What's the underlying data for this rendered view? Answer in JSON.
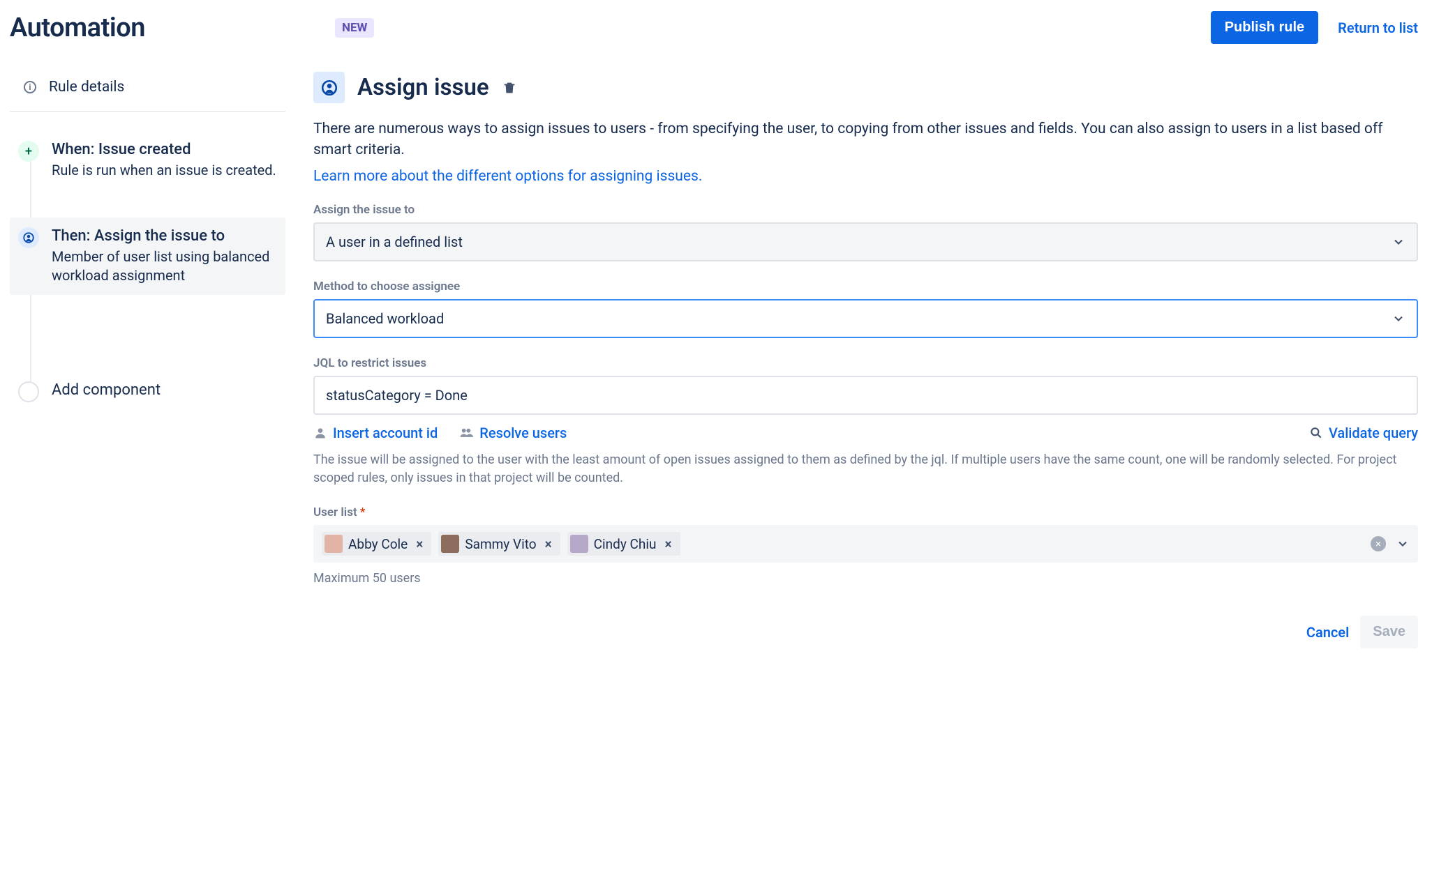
{
  "header": {
    "title": "Automation",
    "badge": "NEW",
    "publish": "Publish rule",
    "return": "Return to list"
  },
  "sidebar": {
    "rule_details": "Rule details",
    "steps": [
      {
        "title": "When: Issue created",
        "sub": "Rule is run when an issue is created."
      },
      {
        "title": "Then: Assign the issue to",
        "sub": "Member of user list using balanced workload assignment"
      }
    ],
    "add_component": "Add component"
  },
  "main": {
    "title": "Assign issue",
    "description": "There are numerous ways to assign issues to users - from specifying the user, to copying from other issues and fields. You can also assign to users in a list based off smart criteria.",
    "learn_more": "Learn more about the different options for assigning issues.",
    "fields": {
      "assign_to_label": "Assign the issue to",
      "assign_to_value": "A user in a defined list",
      "method_label": "Method to choose assignee",
      "method_value": "Balanced workload",
      "jql_label": "JQL to restrict issues",
      "jql_value": "statusCategory = Done",
      "insert_account": "Insert account id",
      "resolve_users": "Resolve users",
      "validate_query": "Validate query",
      "jql_hint": "The issue will be assigned to the user with the least amount of open issues assigned to them as defined by the jql. If multiple users have the same count, one will be randomly selected. For project scoped rules, only issues in that project will be counted.",
      "user_list_label": "User list",
      "users": [
        "Abby Cole",
        "Sammy Vito",
        "Cindy Chiu"
      ],
      "max_users": "Maximum 50 users"
    },
    "actions": {
      "cancel": "Cancel",
      "save": "Save"
    }
  }
}
